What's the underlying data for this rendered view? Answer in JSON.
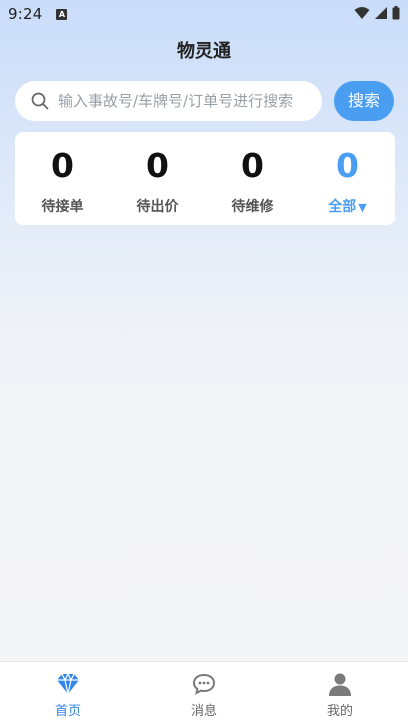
{
  "status_bar": {
    "time": "9:24",
    "app_icon_letter": "A"
  },
  "header": {
    "title": "物灵通"
  },
  "search": {
    "placeholder": "输入事故号/车牌号/订单号进行搜索",
    "button_label": "搜索"
  },
  "stats": [
    {
      "count": "0",
      "label": "待接单"
    },
    {
      "count": "0",
      "label": "待出价"
    },
    {
      "count": "0",
      "label": "待维修"
    },
    {
      "count": "0",
      "label": "全部",
      "caret": "▼"
    }
  ],
  "tabs": [
    {
      "label": "首页",
      "icon": "diamond-icon"
    },
    {
      "label": "消息",
      "icon": "chat-bubble-icon"
    },
    {
      "label": "我的",
      "icon": "person-icon"
    }
  ],
  "colors": {
    "accent": "#4a9ef1",
    "active_tab": "#2f86e6",
    "inactive_icon": "#7a7a7a"
  }
}
